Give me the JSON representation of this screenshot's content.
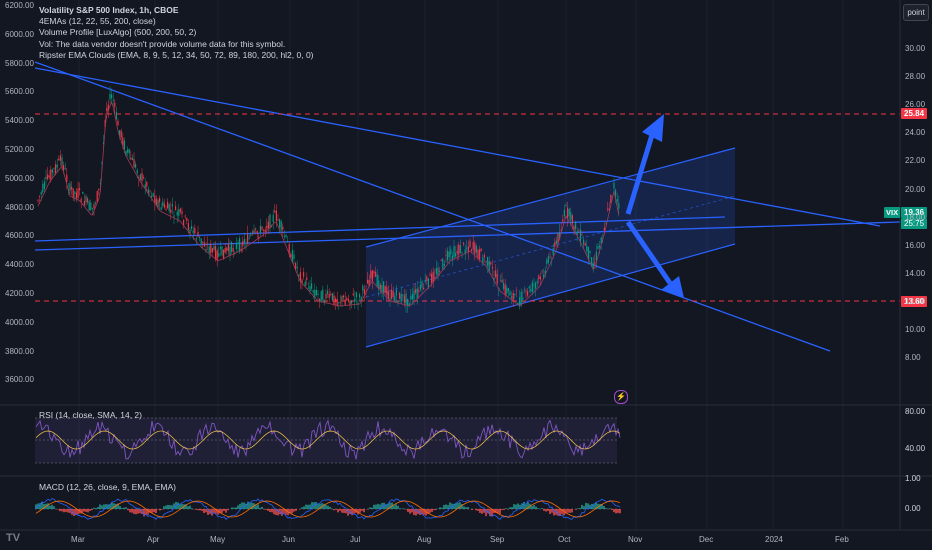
{
  "header": {
    "title": "Volatility S&P 500 Index, 1h, CBOE",
    "indicators": [
      "4EMAs (12, 22, 55, 200, close)",
      "Volume Profile [LuxAlgo] (500, 200, 50, 2)",
      "Vol: The data vendor doesn't provide volume data for this symbol.",
      "Ripster EMA Clouds (EMA, 8, 9, 5, 12, 34, 50, 72, 89, 180, 200, hl2, 0, 0)"
    ]
  },
  "toolbar": {
    "point_label": "point"
  },
  "symbol": {
    "ticker": "VIX",
    "price_tag": "19.36",
    "countdown": "25:75"
  },
  "price_levels": {
    "upper_target": "25.84",
    "lower_target": "13.60"
  },
  "left_axis_labels": [
    "6200.00",
    "6000.00",
    "5800.00",
    "5600.00",
    "5400.00",
    "5200.00",
    "5000.00",
    "4800.00",
    "4600.00",
    "4400.00",
    "4200.00",
    "4000.00",
    "3800.00",
    "3600.00"
  ],
  "right_axis_labels": [
    "30.00",
    "28.00",
    "26.00",
    "24.00",
    "22.00",
    "20.00",
    "18.00",
    "16.00",
    "14.00",
    "12.00",
    "10.00",
    "8.00"
  ],
  "x_axis_labels": [
    "Mar",
    "Apr",
    "May",
    "Jun",
    "Jul",
    "Aug",
    "Sep",
    "Oct",
    "Nov",
    "Dec",
    "2024",
    "Feb"
  ],
  "rsi_panel": {
    "label": "RSI (14, close, SMA, 14, 2)",
    "axis_labels": [
      "80.00",
      "40.00"
    ]
  },
  "macd_panel": {
    "label": "MACD (12, 26, close, 9, EMA, EMA)",
    "axis_labels": [
      "1.00",
      "0.00"
    ]
  },
  "colors": {
    "background": "#131722",
    "trendline": "#2962ff",
    "channel_fill": "#2962ff",
    "candle_up": "#089981",
    "candle_down": "#f23645",
    "rsi_line": "#7e57c2",
    "level_dash": "#f23645"
  },
  "icons": {
    "event": "lightning-icon",
    "logo": "tradingview-logo-icon"
  },
  "logo_text": "TV"
}
